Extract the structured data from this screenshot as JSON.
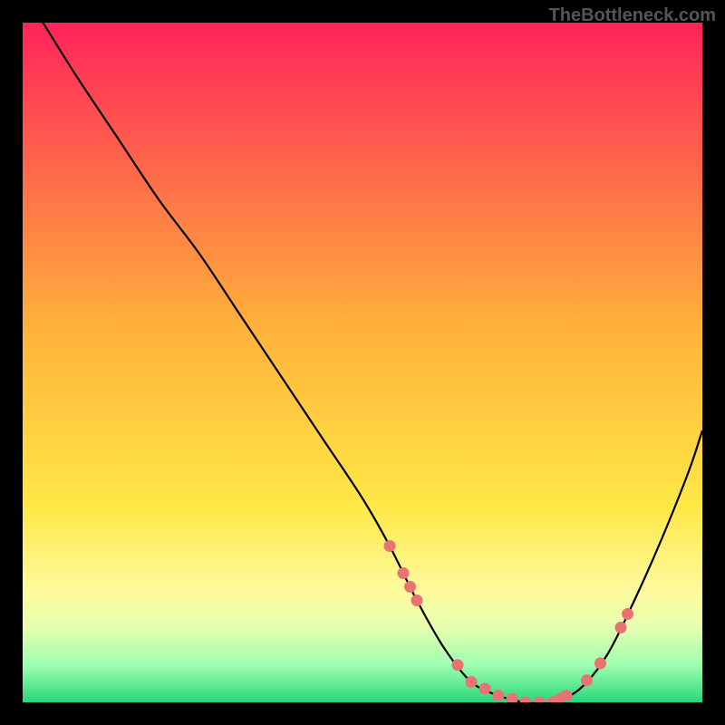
{
  "watermark": "TheBottleneck.com",
  "colors": {
    "gradient": [
      "#ff245a",
      "#ffb23a",
      "#ffe846",
      "#fff99a",
      "#e6ffb0",
      "#9dffb0",
      "#2bd67b"
    ],
    "curve": "#000000",
    "marker": "#e97373"
  },
  "chart_data": {
    "type": "line",
    "title": "",
    "xlabel": "",
    "ylabel": "",
    "xlim": [
      0,
      100
    ],
    "ylim": [
      0,
      100
    ],
    "x": [
      0,
      3,
      8,
      14,
      20,
      26,
      32,
      38,
      44,
      50,
      54,
      58,
      62,
      66,
      70,
      74,
      78,
      82,
      86,
      90,
      94,
      98,
      100
    ],
    "y": [
      105,
      100,
      92,
      83,
      74,
      66,
      57,
      48,
      39,
      30,
      23,
      15,
      8,
      3,
      1,
      0,
      0,
      2,
      7,
      15,
      24,
      34,
      40
    ],
    "markers_x": [
      54,
      56,
      57,
      58,
      64,
      66,
      68,
      70,
      72,
      74,
      76,
      78,
      79,
      80,
      83,
      85,
      88,
      89
    ],
    "legend": []
  }
}
